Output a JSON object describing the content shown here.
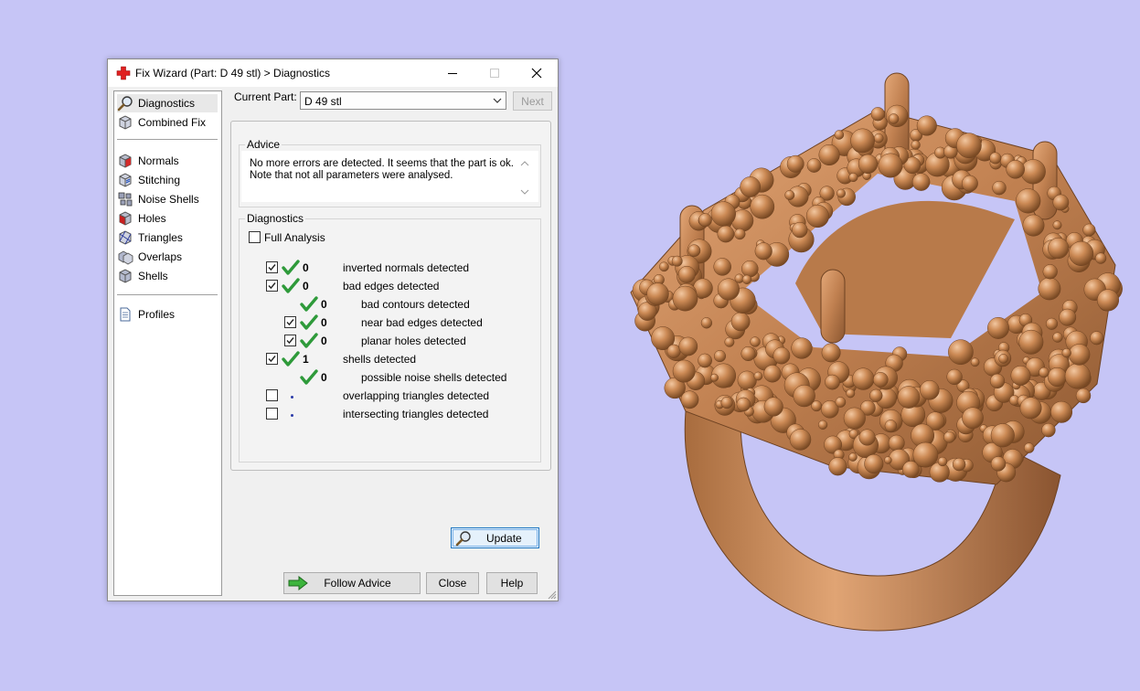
{
  "window": {
    "title": "Fix Wizard (Part: D 49 stl) > Diagnostics",
    "controls": {
      "minimize": "minimize",
      "maximize": "maximize",
      "close": "close"
    }
  },
  "sidebar": {
    "items": [
      {
        "label": "Diagnostics",
        "icon": "magnifier-icon",
        "selected": true
      },
      {
        "label": "Combined Fix",
        "icon": "cube-icon"
      },
      {
        "label": "Normals",
        "icon": "normals-cube-icon"
      },
      {
        "label": "Stitching",
        "icon": "stitching-cube-icon"
      },
      {
        "label": "Noise Shells",
        "icon": "noise-shells-icon"
      },
      {
        "label": "Holes",
        "icon": "holes-cube-icon"
      },
      {
        "label": "Triangles",
        "icon": "triangles-icon"
      },
      {
        "label": "Overlaps",
        "icon": "overlaps-icon"
      },
      {
        "label": "Shells",
        "icon": "shells-icon"
      },
      {
        "label": "Profiles",
        "icon": "document-icon"
      }
    ]
  },
  "current_part": {
    "label": "Current Part:",
    "value": "D 49 stl"
  },
  "next_button": "Next",
  "advice": {
    "title": "Advice",
    "text": "No more errors are detected. It seems that the part is ok. Note that not all parameters were analysed."
  },
  "diagnostics": {
    "title": "Diagnostics",
    "full_analysis": {
      "label": "Full Analysis",
      "checked": false
    },
    "rows": [
      {
        "checked": true,
        "status": "ok",
        "count": "0",
        "label": "inverted normals detected",
        "level": 0,
        "has_checkbox": true
      },
      {
        "checked": true,
        "status": "ok",
        "count": "0",
        "label": "bad edges detected",
        "level": 0,
        "has_checkbox": true
      },
      {
        "checked": false,
        "status": "ok",
        "count": "0",
        "label": "bad contours detected",
        "level": 1,
        "has_checkbox": false
      },
      {
        "checked": true,
        "status": "ok",
        "count": "0",
        "label": "near bad edges detected",
        "level": 1,
        "has_checkbox": true
      },
      {
        "checked": true,
        "status": "ok",
        "count": "0",
        "label": "planar holes detected",
        "level": 1,
        "has_checkbox": true
      },
      {
        "checked": true,
        "status": "ok",
        "count": "1",
        "label": "shells detected",
        "level": 0,
        "has_checkbox": true
      },
      {
        "checked": false,
        "status": "ok",
        "count": "0",
        "label": "possible noise shells detected",
        "level": 1,
        "has_checkbox": false
      },
      {
        "checked": false,
        "status": "not-analysed",
        "count": "",
        "label": "overlapping triangles detected",
        "level": 0,
        "has_checkbox": true
      },
      {
        "checked": false,
        "status": "not-analysed",
        "count": "",
        "label": "intersecting triangles detected",
        "level": 0,
        "has_checkbox": true
      }
    ],
    "update_button": "Update"
  },
  "footer": {
    "follow_advice": "Follow Advice",
    "close": "Close",
    "help": "Help"
  },
  "colors": {
    "desktop": "#c6c5f6",
    "ring": "#c98a55",
    "check": "#2e9a3a",
    "focus": "#1e76c2"
  }
}
